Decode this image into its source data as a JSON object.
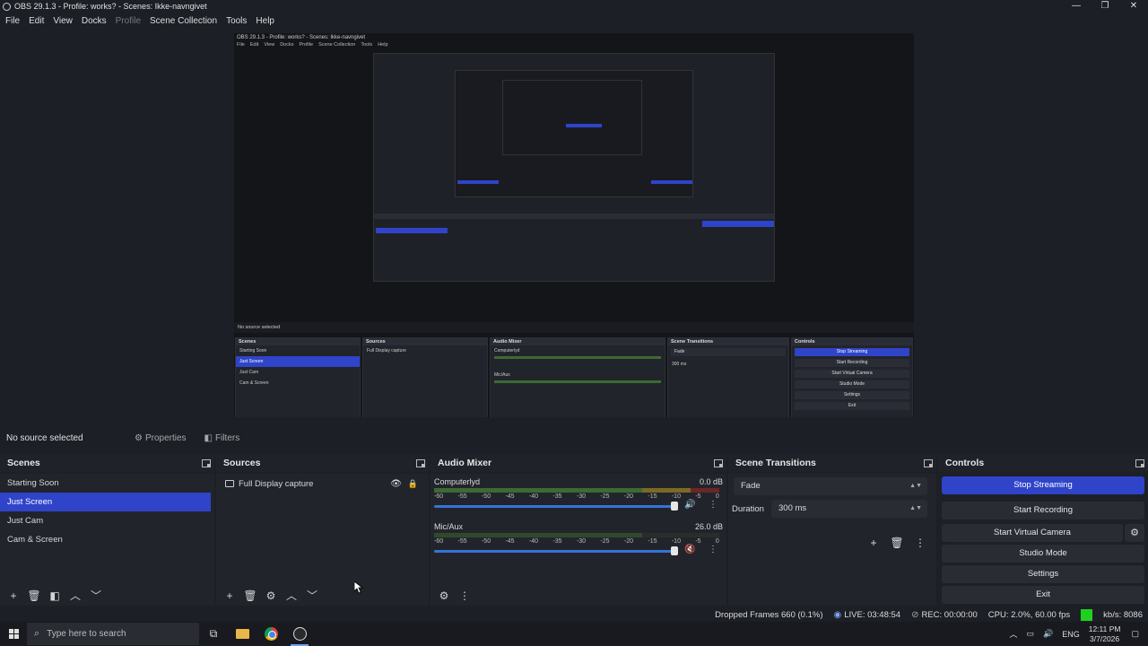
{
  "window": {
    "title": "OBS 29.1.3 - Profile: works? - Scenes: Ikke-navngivet",
    "controls": [
      "—",
      "❐",
      "✕"
    ]
  },
  "menu": [
    "File",
    "Edit",
    "View",
    "Docks",
    "Profile",
    "Scene Collection",
    "Tools",
    "Help"
  ],
  "source_bar": {
    "no_source": "No source selected",
    "properties": "Properties",
    "filters": "Filters"
  },
  "scenes": {
    "title": "Scenes",
    "items": [
      "Starting Soon",
      "Just Screen",
      "Just Cam",
      "Cam & Screen"
    ],
    "selected_index": 1
  },
  "sources": {
    "title": "Sources",
    "items": [
      "Full Display capture"
    ]
  },
  "mixer": {
    "title": "Audio Mixer",
    "scale": [
      "-60",
      "-55",
      "-50",
      "-45",
      "-40",
      "-35",
      "-30",
      "-25",
      "-20",
      "-15",
      "-10",
      "-5",
      "0"
    ],
    "channels": [
      {
        "name": "Computerlyd",
        "db": "0.0 dB",
        "muted": false,
        "level": 1.0
      },
      {
        "name": "Mic/Aux",
        "db": "26.0 dB",
        "muted": true,
        "level": 1.0
      }
    ]
  },
  "transitions": {
    "title": "Scene Transitions",
    "selected": "Fade",
    "duration_label": "Duration",
    "duration": "300 ms"
  },
  "controls": {
    "title": "Controls",
    "stop_streaming": "Stop Streaming",
    "start_recording": "Start Recording",
    "start_virtual_camera": "Start Virtual Camera",
    "studio_mode": "Studio Mode",
    "settings": "Settings",
    "exit": "Exit"
  },
  "status": {
    "dropped": "Dropped Frames 660 (0.1%)",
    "live": "LIVE: 03:48:54",
    "rec": "REC: 00:00:00",
    "cpu": "CPU: 2.0%, 60.00 fps",
    "kbs": "kb/s: 8086"
  },
  "taskbar": {
    "search_placeholder": "Type here to search",
    "lang": "ENG",
    "time": "12:11 PM",
    "date": "3/7/2026"
  },
  "colors": {
    "accent": "#2f44c8",
    "background": "#1d1f26",
    "live_indicator": "#1fd11f"
  }
}
